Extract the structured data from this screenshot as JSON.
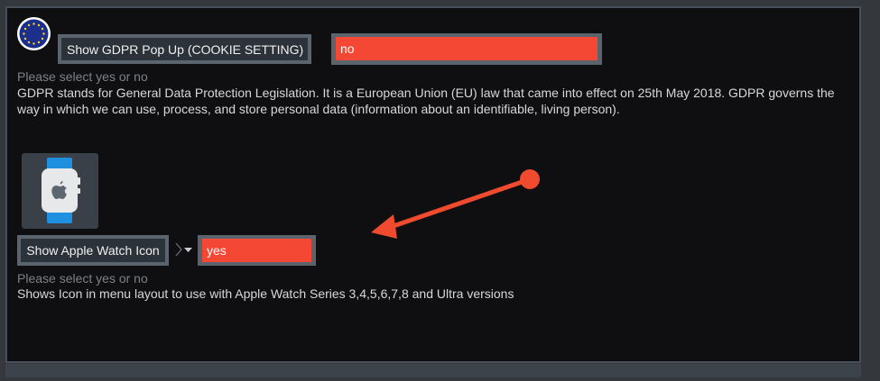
{
  "gdpr": {
    "button_label": "Show GDPR Pop Up (COOKIE SETTING)",
    "value": "no",
    "hint": "Please select yes or no",
    "description": "GDPR stands for General Data Protection Legislation. It is a European Union (EU) law that came into effect on 25th May 2018. GDPR governs the way in which we can use, process, and store personal data (information about an identifiable, living person)."
  },
  "watch": {
    "button_label": "Show Apple Watch Icon",
    "value": "yes",
    "hint": "Please select yes or no",
    "description": "Shows Icon in menu layout to use with Apple Watch Series 3,4,5,6,7,8 and Ultra versions"
  },
  "icons": {
    "gdpr": "eu-flag-icon",
    "watch": "apple-watch-icon",
    "dropdown": "chevron-down-icon"
  },
  "colors": {
    "field_background": "#f44734",
    "annotation_arrow": "#f04a2f",
    "panel_background": "#0f0f11"
  }
}
